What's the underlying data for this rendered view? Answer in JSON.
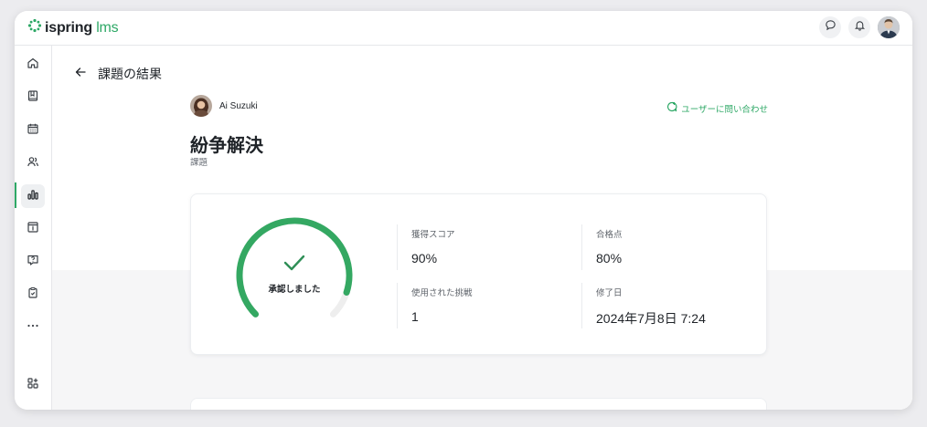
{
  "app": {
    "logo_primary": "ispring",
    "logo_secondary": "lms",
    "brand_color": "#2ea866"
  },
  "topbar": {
    "icons": [
      "chat-icon",
      "bell-icon"
    ],
    "avatar": "user-avatar"
  },
  "sidebar": {
    "items": [
      {
        "name": "home-icon",
        "active": false
      },
      {
        "name": "book-icon",
        "active": false
      },
      {
        "name": "calendar-icon",
        "active": false
      },
      {
        "name": "users-icon",
        "active": false
      },
      {
        "name": "chart-icon",
        "active": true
      },
      {
        "name": "catalog-icon",
        "active": false
      },
      {
        "name": "help-icon",
        "active": false
      },
      {
        "name": "clipboard-check-icon",
        "active": false
      },
      {
        "name": "more-icon",
        "active": false
      }
    ],
    "bottom_icon": "apps-add-icon"
  },
  "page": {
    "title": "課題の結果",
    "user_name": "Ai Suzuki",
    "contact_label": "ユーザーに問い合わせ",
    "assignment_title": "紛争解決",
    "assignment_type": "課題"
  },
  "result": {
    "status_label": "承認しました",
    "score_fraction": 0.9,
    "stats": {
      "score_label": "獲得スコア",
      "score_value": "90%",
      "passing_label": "合格点",
      "passing_value": "80%",
      "attempts_label": "使用された挑戦",
      "attempts_value": "1",
      "completed_label": "修了日",
      "completed_value": "2024年7月8日 7:24"
    }
  }
}
